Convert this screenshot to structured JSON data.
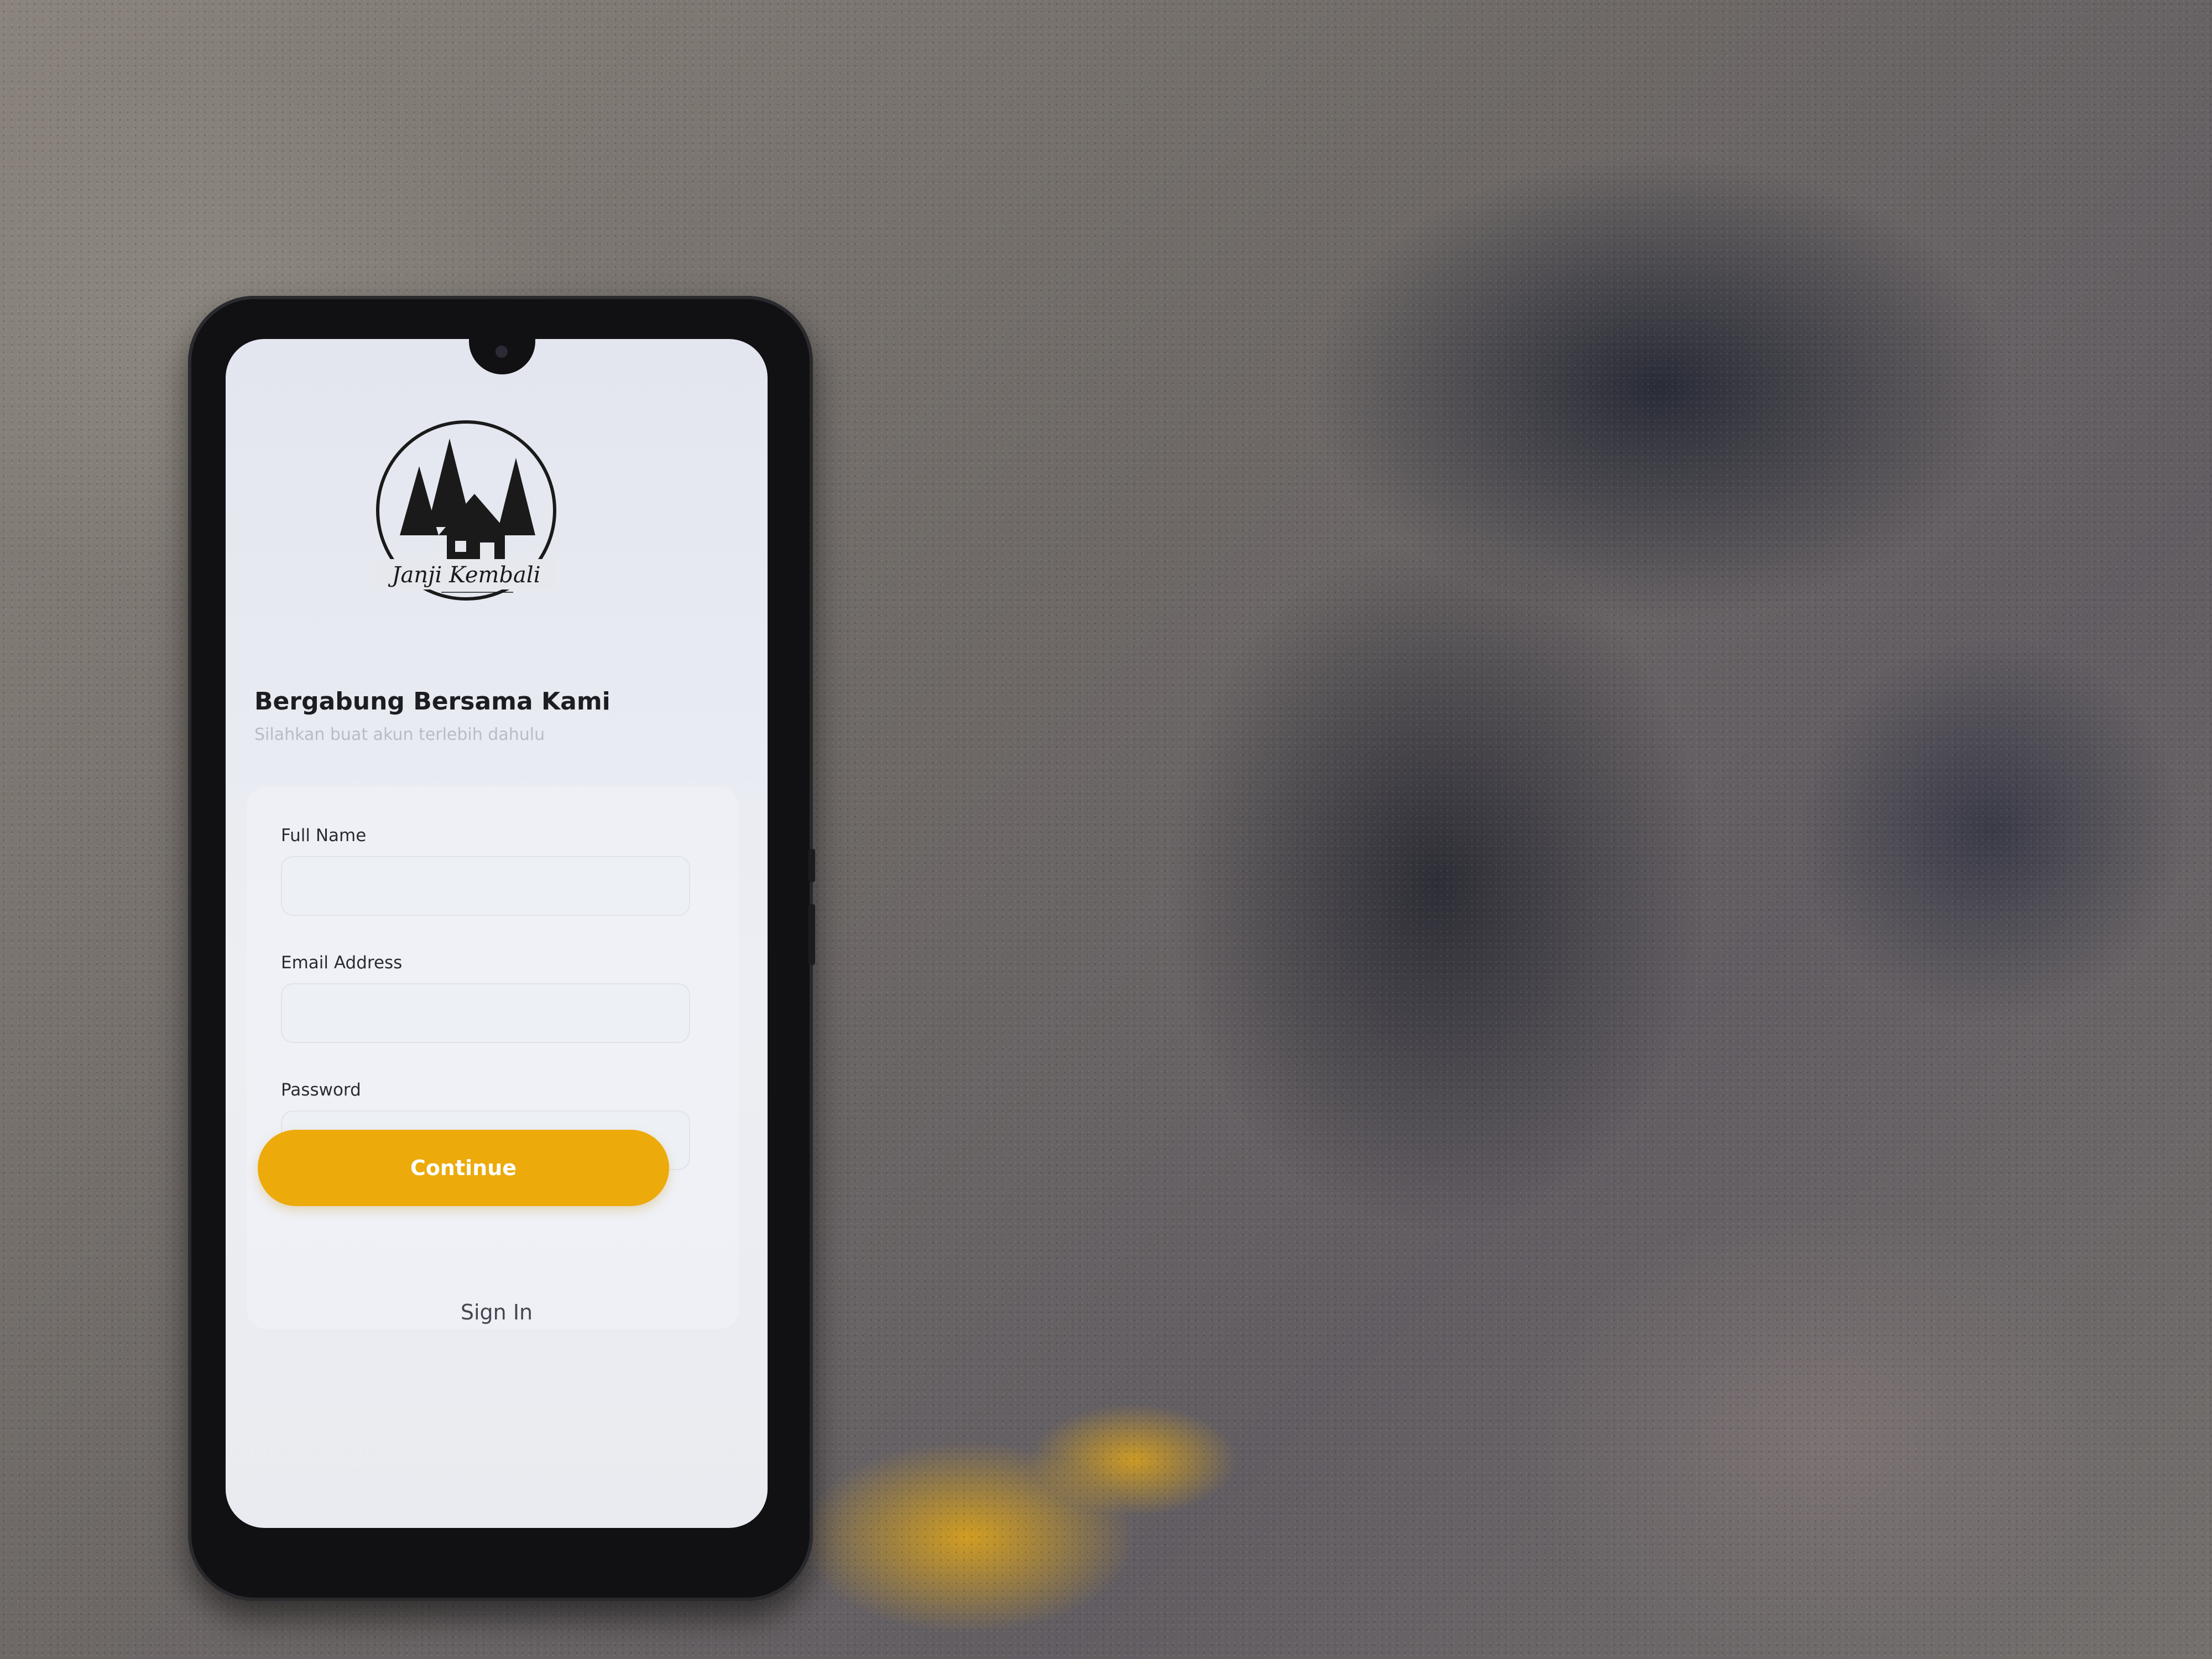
{
  "app": {
    "logo_text": "Janji Kembali"
  },
  "signup": {
    "title": "Bergabung Bersama Kami",
    "subtitle": "Silahkan buat akun terlebih dahulu",
    "fields": [
      {
        "label": "Full Name",
        "value": ""
      },
      {
        "label": "Email Address",
        "value": ""
      },
      {
        "label": "Password",
        "value": ""
      }
    ],
    "continue_label": "Continue",
    "signin_label": "Sign In"
  },
  "colors": {
    "accent": "#ECAA0B",
    "screen_bg": "#E8EAF0",
    "title": "#1B1D22"
  }
}
